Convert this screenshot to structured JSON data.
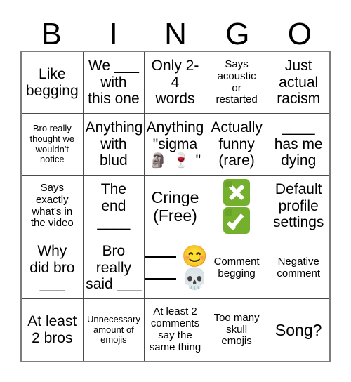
{
  "card": {
    "title": "BINGO",
    "header_letters": [
      "B",
      "I",
      "N",
      "G",
      "O"
    ],
    "accent_green": "#74b02e",
    "border_color": "#4a4a4a",
    "outer_border_color": "#7d7d7d",
    "text_color": "#000000",
    "background": "#ffffff",
    "grid_size": "5x5",
    "free_space_label": "Cringe\n(Free)"
  },
  "cells": [
    {
      "id": "b1",
      "column": "B",
      "row": 1,
      "text": "Like\nbegging",
      "size": "md",
      "kind": "text"
    },
    {
      "id": "i1",
      "column": "I",
      "row": 1,
      "text": "We ___\nwith\nthis one",
      "size": "md",
      "kind": "text"
    },
    {
      "id": "n1",
      "column": "N",
      "row": 1,
      "text": "Only 2-\n4\nwords",
      "size": "md",
      "kind": "text"
    },
    {
      "id": "g1",
      "column": "G",
      "row": 1,
      "text": "Says\nacoustic\nor\nrestarted",
      "size": "sm",
      "kind": "text"
    },
    {
      "id": "o1",
      "column": "O",
      "row": 1,
      "text": "Just\nactual\nracism",
      "size": "md",
      "kind": "text"
    },
    {
      "id": "b2",
      "column": "B",
      "row": 2,
      "text": "Bro really\nthought we\nwouldn't\nnotice",
      "size": "xs",
      "kind": "text"
    },
    {
      "id": "i2",
      "column": "I",
      "row": 2,
      "text": "Anything\nwith blud",
      "size": "md",
      "kind": "text"
    },
    {
      "id": "n2",
      "column": "N",
      "row": 2,
      "text": "Anything\n\"sigma",
      "suffix_emoji": [
        "🗿",
        "🍷"
      ],
      "suffix_text": "\"",
      "size": "md",
      "kind": "text-emoji"
    },
    {
      "id": "g2",
      "column": "G",
      "row": 2,
      "text": "Actually\nfunny\n(rare)",
      "size": "md",
      "kind": "text"
    },
    {
      "id": "o2",
      "column": "O",
      "row": 2,
      "text": "____\nhas me\ndying",
      "size": "md",
      "kind": "text"
    },
    {
      "id": "b3",
      "column": "B",
      "row": 3,
      "text": "Says\nexactly\nwhat's in\nthe video",
      "size": "sm",
      "kind": "text"
    },
    {
      "id": "i3",
      "column": "I",
      "row": 3,
      "text": "The\nend\n____",
      "size": "md",
      "kind": "text"
    },
    {
      "id": "n3",
      "column": "N",
      "row": 3,
      "text": "Cringe\n(Free)",
      "size": "lg",
      "kind": "free-space"
    },
    {
      "id": "g3",
      "column": "G",
      "row": 3,
      "emoji": [
        "❎",
        "✅"
      ],
      "emoji_names": [
        "cross-mark-button-emoji",
        "check-mark-button-emoji"
      ],
      "kind": "emoji-only"
    },
    {
      "id": "o3",
      "column": "O",
      "row": 3,
      "text": "Default\nprofile\nsettings",
      "size": "md",
      "kind": "text"
    },
    {
      "id": "b4",
      "column": "B",
      "row": 4,
      "text": "Why\ndid bro\n___",
      "size": "md",
      "kind": "text"
    },
    {
      "id": "i4",
      "column": "I",
      "row": 4,
      "text": "Bro\nreally\nsaid ___",
      "size": "md",
      "kind": "text"
    },
    {
      "id": "n4",
      "column": "N",
      "row": 4,
      "rows_emoji": [
        "😊",
        "💀"
      ],
      "emoji_names": [
        "smiling-face-emoji",
        "skull-emoji"
      ],
      "blank_label": "___",
      "kind": "blank-emoji-rows"
    },
    {
      "id": "g4",
      "column": "G",
      "row": 4,
      "text": "Comment\nbegging",
      "size": "sm",
      "kind": "text"
    },
    {
      "id": "o4",
      "column": "O",
      "row": 4,
      "text": "Negative\ncomment",
      "size": "sm",
      "kind": "text"
    },
    {
      "id": "b5",
      "column": "B",
      "row": 5,
      "text": "At least\n2 bros",
      "size": "md",
      "kind": "text"
    },
    {
      "id": "i5",
      "column": "I",
      "row": 5,
      "text": "Unnecessary\namount of\nemojis",
      "size": "xs",
      "kind": "text"
    },
    {
      "id": "n5",
      "column": "N",
      "row": 5,
      "text": "At least 2\ncomments\nsay the\nsame thing",
      "size": "sm",
      "kind": "text"
    },
    {
      "id": "g5",
      "column": "G",
      "row": 5,
      "text": "Too many\nskull\nemojis",
      "size": "sm",
      "kind": "text"
    },
    {
      "id": "o5",
      "column": "O",
      "row": 5,
      "text": "Song?",
      "size": "lg",
      "kind": "text"
    }
  ]
}
